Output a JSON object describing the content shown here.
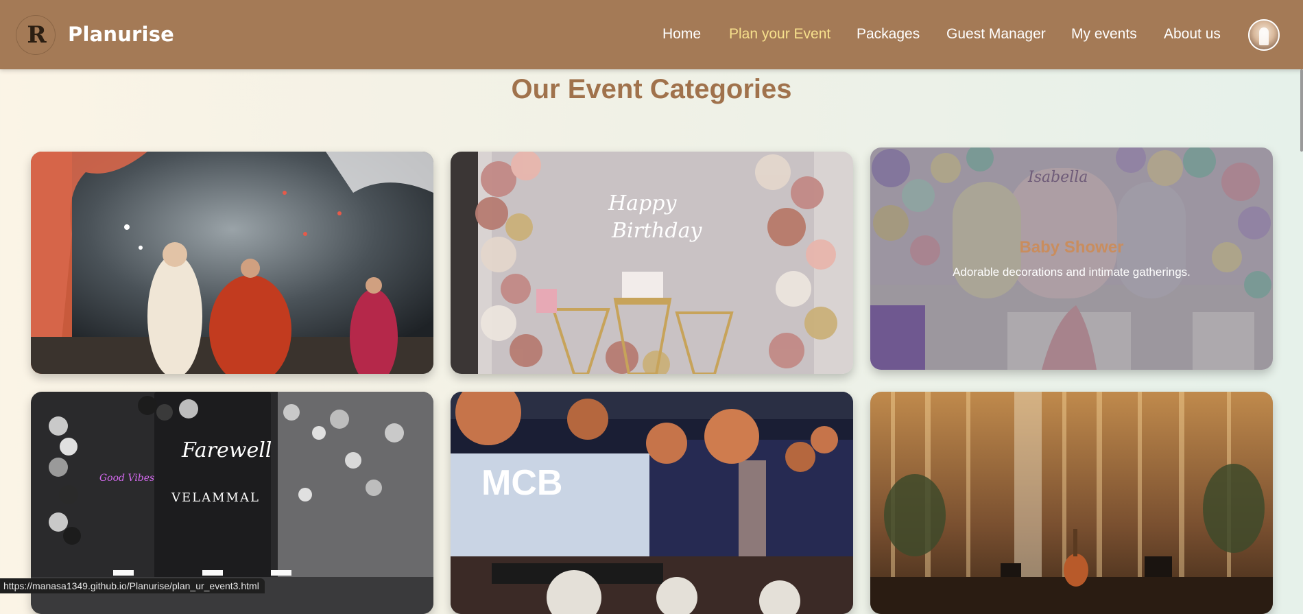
{
  "navbar": {
    "logo_letter": "R",
    "brand": "Planurise",
    "links": [
      {
        "label": "Home",
        "active": false
      },
      {
        "label": "Plan your Event",
        "active": true
      },
      {
        "label": "Packages",
        "active": false
      },
      {
        "label": "Guest Manager",
        "active": false
      },
      {
        "label": "My events",
        "active": false
      },
      {
        "label": "About us",
        "active": false
      }
    ],
    "active_color": "#f7e08c",
    "bar_color": "#a47a56"
  },
  "main": {
    "title": "Our Event Categories",
    "cards": [
      {
        "image": "wedding",
        "title": "",
        "description": ""
      },
      {
        "image": "birthday",
        "title": "",
        "description": ""
      },
      {
        "image": "baby-shower",
        "title": "Baby Shower",
        "description": "Adorable decorations and intimate gatherings."
      },
      {
        "image": "farewell",
        "title": "",
        "description": ""
      },
      {
        "image": "corporate-gala",
        "title": "",
        "description": ""
      },
      {
        "image": "concert",
        "title": "",
        "description": ""
      }
    ]
  },
  "status_bar": {
    "url": "https://manasa1349.github.io/Planurise/plan_ur_event3.html"
  }
}
